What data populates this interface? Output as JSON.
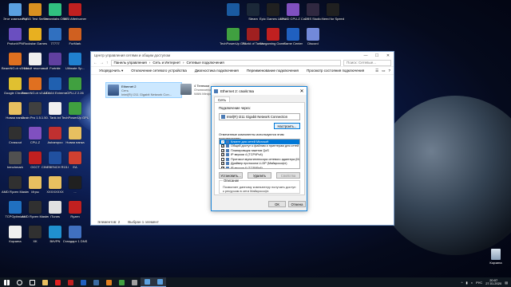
{
  "desktop_icons": [
    {
      "label": "Этот компьютер",
      "color": "#5aa0e0"
    },
    {
      "label": "PUBG Test Server",
      "color": "#d89020"
    },
    {
      "label": "Streamlabs OBS",
      "color": "#30c080"
    },
    {
      "label": "MSI Afterburner",
      "color": "#c02020"
    },
    {
      "label": "ProtonVPN",
      "color": "#6a4fc0"
    },
    {
      "label": "Rockstar Games",
      "color": "#e8b020"
    },
    {
      "label": "77777",
      "color": "#3070c0"
    },
    {
      "label": "FurMark",
      "color": "#d06020"
    },
    {
      "label": "BeamNG.dr v0.10.0.0",
      "color": "#e07020"
    },
    {
      "label": "Новый текстовый",
      "color": "#f0f0f0"
    },
    {
      "label": "Fortnite",
      "color": "#6040a0"
    },
    {
      "label": "Ultimate Sp...",
      "color": "#2080d0"
    },
    {
      "label": "Google Chrome",
      "color": "#e0c030"
    },
    {
      "label": "BeamNG.dr v0.19.0.0",
      "color": "#e07020"
    },
    {
      "label": "AIDA64 Extreme",
      "color": "#2060b0"
    },
    {
      "label": "GPU-Z 2.26",
      "color": "#40a040"
    },
    {
      "label": "Новая папка",
      "color": "#e8c060"
    },
    {
      "label": "Grain Pro 1.5.1.50.30",
      "color": "#404040"
    },
    {
      "label": "Tank.txt",
      "color": "#f0f0f0"
    },
    {
      "label": "TechPowerUp GPU-Z",
      "color": "#40a040"
    },
    {
      "label": "Crossout",
      "color": "#303030"
    },
    {
      "label": "CPU-Z",
      "color": "#8050c0"
    },
    {
      "label": "Ashampoo",
      "color": "#c03030"
    },
    {
      "label": "Новая папка",
      "color": "#e8c060"
    },
    {
      "label": "benchmark",
      "color": "#505050"
    },
    {
      "label": "OCCT",
      "color": "#c02020"
    },
    {
      "label": "CINEBENCH R15.038",
      "color": "#2050a0"
    },
    {
      "label": "EA",
      "color": "#d04030"
    },
    {
      "label": "AMD Ryzen Master",
      "color": "#303030"
    },
    {
      "label": "Игры",
      "color": "#e8c060"
    },
    {
      "label": "XXXXXXXX",
      "color": "#e8c060"
    },
    {
      "label": "...",
      "color": "#202020"
    },
    {
      "label": "TCPOptimizer",
      "color": "#2070c0"
    },
    {
      "label": "AMD Ryzen Master",
      "color": "#303030"
    },
    {
      "label": "iTunes",
      "color": "#e0e0e0"
    },
    {
      "label": "Ryzen",
      "color": "#c02020"
    },
    {
      "label": "Корзина",
      "color": "#f0f0f0"
    },
    {
      "label": "XK",
      "color": "#303030"
    },
    {
      "label": "BitVPN",
      "color": "#2090d0"
    },
    {
      "label": "Стандарт 1 DNS",
      "color": "#4070c0"
    },
    {
      "label": "",
      "color": "#1a5aa0"
    },
    {
      "label": "Steam",
      "color": "#1b2838"
    },
    {
      "label": "Epic Games Launcher",
      "color": "#202020"
    },
    {
      "label": "CPUID CPU-Z Counter Str...",
      "color": "#8050c0"
    },
    {
      "label": "OBS Studio",
      "color": "#302840"
    },
    {
      "label": "Need for Speed",
      "color": "#202020"
    },
    {
      "label": "TechPowerUp GPU-Z",
      "color": "#40a040"
    },
    {
      "label": "World of Tanks",
      "color": "#a02020"
    },
    {
      "label": "Wargaming Game Center",
      "color": "#c02020"
    },
    {
      "label": "Game Center",
      "color": "#2060c0"
    },
    {
      "label": "Discord",
      "color": "#7289da"
    }
  ],
  "explorer": {
    "title": "Центр управления сетями и общим доступом",
    "window_controls": [
      "—",
      "☐",
      "✕"
    ],
    "breadcrumb": [
      "Панель управления",
      "Сеть и Интернет",
      "Сетевые подключения"
    ],
    "search_placeholder": "Поиск: Сетевые...",
    "commands": [
      "Упорядочить ▾",
      "Отключение сетевого устройства",
      "Диагностика подключения",
      "Переименование подключения",
      "Просмотр состояния подключения"
    ],
    "adapters": [
      {
        "name": "Ethernet 2",
        "status": "Сеть",
        "device": "Intel(R) I211 Gigabit Network Con..."
      },
      {
        "name": "4 Телеком",
        "status": "Отключено",
        "device": "WAN Miniport (PPPOE)"
      }
    ],
    "status_items": [
      "Элементов: 2",
      "Выбран 1 элемент"
    ]
  },
  "dialog": {
    "title": "Ethernet 2: свойства",
    "close": "✕",
    "tab": "Сеть",
    "connect_label": "Подключение через:",
    "device": "Intel(R) I211 Gigabit Network Connection",
    "configure_button": "Настроить...",
    "components_label": "Отмеченные компоненты используются этим подключением:",
    "components": [
      {
        "checked": true,
        "label": "Клиент для сетей Microsoft",
        "selected": true
      },
      {
        "checked": true,
        "label": "Общий доступ к файлам и принтерам для сетей Mi...",
        "selected": false
      },
      {
        "checked": true,
        "label": "Планировщик пакетов QoS",
        "selected": false
      },
      {
        "checked": true,
        "label": "IP версии 4 (TCP/IPv4)",
        "selected": false
      },
      {
        "checked": false,
        "label": "Протокол мультиплексора сетевого адаптера (Ma...",
        "selected": false
      },
      {
        "checked": true,
        "label": "Драйвер протокола LLDP (Майкрософт)",
        "selected": false
      },
      {
        "checked": true,
        "label": "IP версии 6 (TCP/IPv6)",
        "selected": false
      }
    ],
    "install_button": "Установить...",
    "remove_button": "Удалить",
    "properties_button": "Свойства",
    "desc_label": "Описание",
    "description": "Позволяет данному компьютеру получать доступ к ресурсам в сети Майкрософт.",
    "ok_button": "ОК",
    "cancel_button": "Отмена"
  },
  "recycle_bin": {
    "label": "Корзина"
  },
  "taskbar": {
    "items": [
      {
        "name": "start",
        "color": "#ffffff"
      },
      {
        "name": "search",
        "color": "#ffffff"
      },
      {
        "name": "task-view",
        "color": "#ffffff"
      },
      {
        "name": "explorer",
        "color": "#e8c060"
      },
      {
        "name": "opera",
        "color": "#e02020"
      },
      {
        "name": "app-red",
        "color": "#c02020"
      },
      {
        "name": "app-blue",
        "color": "#2060c0"
      },
      {
        "name": "app-steam",
        "color": "#3a6aa0"
      },
      {
        "name": "app-orange",
        "color": "#e08020"
      },
      {
        "name": "app-green",
        "color": "#40a040"
      },
      {
        "name": "settings",
        "color": "#a0a0a0"
      },
      {
        "name": "control-panel",
        "color": "#5aa0e0"
      },
      {
        "name": "network",
        "color": "#5aa0e0"
      }
    ],
    "lang": "РУС",
    "time": "20:07",
    "date": "27.01.2020"
  }
}
